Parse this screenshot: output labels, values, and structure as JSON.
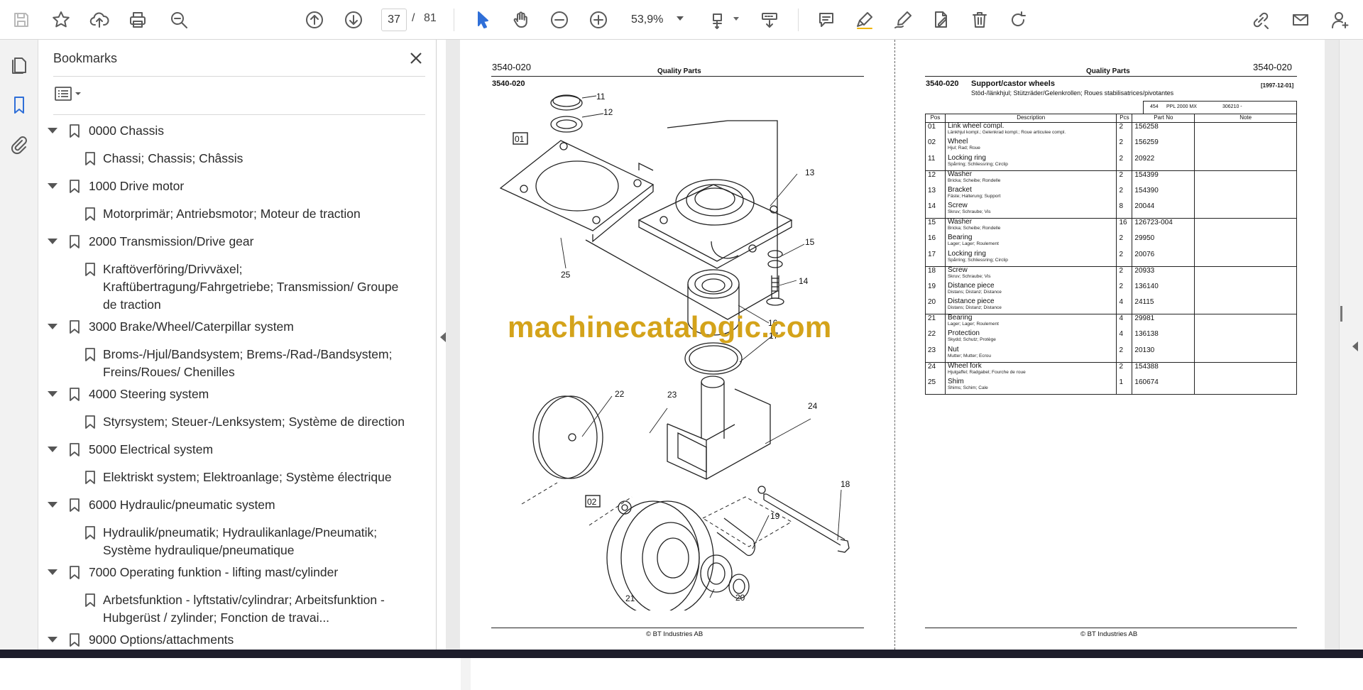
{
  "toolbar": {
    "page_current": "37",
    "page_separator": "/",
    "page_total": "81",
    "zoom_value": "53,9%"
  },
  "sidebar": {
    "title": "Bookmarks",
    "items": [
      {
        "label": "0000 Chassis"
      },
      {
        "label": "Chassi; Chassis; Châssis"
      },
      {
        "label": "1000 Drive motor"
      },
      {
        "label": "Motorprimär; Antriebsmotor; Moteur de traction"
      },
      {
        "label": "2000 Transmission/Drive gear"
      },
      {
        "label": "Kraftöverföring/Drivväxel;"
      },
      {
        "label": "Kraftübertragung/Fahrgetriebe; Transmission/ Groupe"
      },
      {
        "label": "de traction"
      },
      {
        "label": "3000 Brake/Wheel/Caterpillar system"
      },
      {
        "label": "Broms-/Hjul/Bandsystem; Brems-/Rad-/Bandsystem;"
      },
      {
        "label": "Freins/Roues/ Chenilles"
      },
      {
        "label": "4000 Steering system"
      },
      {
        "label": "Styrsystem; Steuer-/Lenksystem; Système de direction"
      },
      {
        "label": "5000 Electrical system"
      },
      {
        "label": "Elektriskt system; Elektroanlage; Système électrique"
      },
      {
        "label": "6000 Hydraulic/pneumatic system"
      },
      {
        "label": "Hydraulik/pneumatik; Hydraulikanlage/Pneumatik;"
      },
      {
        "label": "Système hydraulique/pneumatique"
      },
      {
        "label": "7000 Operating funktion - lifting mast/cylinder"
      },
      {
        "label": "Arbetsfunktion - lyftstativ/cylindrar; Arbeitsfunktion -"
      },
      {
        "label": "Hubgerüst / zylinder; Fonction de travai..."
      },
      {
        "label": "9000 Options/attachments"
      }
    ]
  },
  "left_page": {
    "code_top": "3540-020",
    "header": "Quality Parts",
    "code_sub": "3540-020",
    "callouts": [
      "01",
      "02",
      "11",
      "12",
      "13",
      "14",
      "15",
      "16",
      "17",
      "18",
      "19",
      "20",
      "21",
      "22",
      "23",
      "24",
      "25"
    ],
    "footer": "© BT Industries AB"
  },
  "watermark": "machinecatalogic.com",
  "right_page": {
    "header": "Quality Parts",
    "code_top": "3540-020",
    "code_sub": "3540-020",
    "title": "Support/castor wheels",
    "subtitle": "Stöd-/länkhjul; Stützräder/Gelenkrollen; Roues stabilisatrices/pivotantes",
    "date": "[1997-12-01]",
    "model_num": "454",
    "model_name": "PPL 2000 MX",
    "serial": "306210 -",
    "columns": [
      "Pos",
      "Description",
      "Pcs",
      "Part No",
      "Note"
    ],
    "rows": [
      {
        "pos": "01",
        "desc": "Link wheel compl.",
        "sub": "Länkhjul kompl.; Gelenkrad kompl.; Roue articulee compl.",
        "pcs": "2",
        "part": "156258"
      },
      {
        "pos": "02",
        "desc": "Wheel",
        "sub": "Hjul; Rad; Roue",
        "pcs": "2",
        "part": "156259"
      },
      {
        "pos": "11",
        "desc": "Locking ring",
        "sub": "Spårring; Schliessring; Circlip",
        "pcs": "2",
        "part": "20922"
      },
      {
        "pos": "12",
        "desc": "Washer",
        "sub": "Bricka; Scheibe; Rondelle",
        "pcs": "2",
        "part": "154399"
      },
      {
        "pos": "13",
        "desc": "Bracket",
        "sub": "Fäste; Halterung; Support",
        "pcs": "2",
        "part": "154390"
      },
      {
        "pos": "14",
        "desc": "Screw",
        "sub": "Skruv; Schraube; Vis",
        "pcs": "8",
        "part": "20044"
      },
      {
        "pos": "15",
        "desc": "Washer",
        "sub": "Bricka; Scheibe; Rondelle",
        "pcs": "16",
        "part": "126723-004"
      },
      {
        "pos": "16",
        "desc": "Bearing",
        "sub": "Lager; Lager; Roulement",
        "pcs": "2",
        "part": "29950"
      },
      {
        "pos": "17",
        "desc": "Locking ring",
        "sub": "Spårring; Schliessring; Circlip",
        "pcs": "2",
        "part": "20076"
      },
      {
        "pos": "18",
        "desc": "Screw",
        "sub": "Skruv; Schraube; Vis",
        "pcs": "2",
        "part": "20933"
      },
      {
        "pos": "19",
        "desc": "Distance piece",
        "sub": "Distans; Distanz; Distance",
        "pcs": "2",
        "part": "136140"
      },
      {
        "pos": "20",
        "desc": "Distance piece",
        "sub": "Distans; Distanz; Distance",
        "pcs": "4",
        "part": "24115"
      },
      {
        "pos": "21",
        "desc": "Bearing",
        "sub": "Lager; Lager; Roulement",
        "pcs": "4",
        "part": "29981"
      },
      {
        "pos": "22",
        "desc": "Protection",
        "sub": "Skydd; Schutz; Protège",
        "pcs": "4",
        "part": "136138"
      },
      {
        "pos": "23",
        "desc": "Nut",
        "sub": "Mutter; Mutter; Ecrou",
        "pcs": "2",
        "part": "20130"
      },
      {
        "pos": "24",
        "desc": "Wheel fork",
        "sub": "Hjulgaffel; Radgabel; Fourche de roue",
        "pcs": "2",
        "part": "154388"
      },
      {
        "pos": "25",
        "desc": "Shim",
        "sub": "Shims; Schim; Cale",
        "pcs": "1",
        "part": "160674"
      }
    ],
    "footer": "© BT Industries AB"
  }
}
